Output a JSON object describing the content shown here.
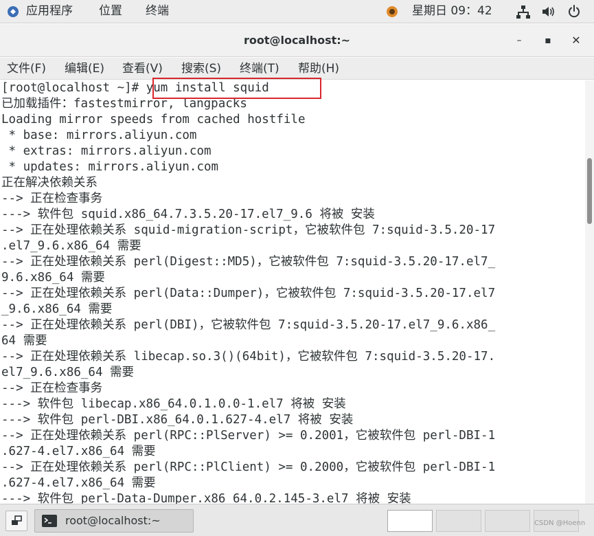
{
  "top_panel": {
    "applications": "应用程序",
    "places": "位置",
    "terminal": "终端",
    "clock": "星期日 09：42"
  },
  "window": {
    "title": "root@localhost:~",
    "minimize": "–",
    "maximize": "▪",
    "close": "✕"
  },
  "menu": [
    "文件(F)",
    "编辑(E)",
    "查看(V)",
    "搜索(S)",
    "终端(T)",
    "帮助(H)"
  ],
  "terminal_lines": [
    "[root@localhost ~]# yum install squid",
    "已加载插件：fastestmirror, langpacks",
    "Loading mirror speeds from cached hostfile",
    " * base: mirrors.aliyun.com",
    " * extras: mirrors.aliyun.com",
    " * updates: mirrors.aliyun.com",
    "正在解决依赖关系",
    "--> 正在检查事务",
    "---> 软件包 squid.x86_64.7.3.5.20-17.el7_9.6 将被 安装",
    "--> 正在处理依赖关系 squid-migration-script，它被软件包 7:squid-3.5.20-17",
    ".el7_9.6.x86_64 需要",
    "--> 正在处理依赖关系 perl(Digest::MD5)，它被软件包 7:squid-3.5.20-17.el7_",
    "9.6.x86_64 需要",
    "--> 正在处理依赖关系 perl(Data::Dumper)，它被软件包 7:squid-3.5.20-17.el7",
    "_9.6.x86_64 需要",
    "--> 正在处理依赖关系 perl(DBI)，它被软件包 7:squid-3.5.20-17.el7_9.6.x86_",
    "64 需要",
    "--> 正在处理依赖关系 libecap.so.3()(64bit)，它被软件包 7:squid-3.5.20-17.",
    "el7_9.6.x86_64 需要",
    "--> 正在检查事务",
    "---> 软件包 libecap.x86_64.0.1.0.0-1.el7 将被 安装",
    "---> 软件包 perl-DBI.x86_64.0.1.627-4.el7 将被 安装",
    "--> 正在处理依赖关系 perl(RPC::PlServer) >= 0.2001，它被软件包 perl-DBI-1",
    ".627-4.el7.x86_64 需要",
    "--> 正在处理依赖关系 perl(RPC::PlClient) >= 0.2000，它被软件包 perl-DBI-1",
    ".627-4.el7.x86_64 需要",
    "---> 软件包 perl-Data-Dumper.x86_64.0.2.145-3.el7 将被 安装"
  ],
  "taskbar": {
    "task_label": "root@localhost:~"
  },
  "watermark": "CSDN @Hoenn",
  "colors": {
    "highlight": "#d9262c",
    "terminal_fg": "#2e3436",
    "terminal_bg": "#ffffff"
  }
}
